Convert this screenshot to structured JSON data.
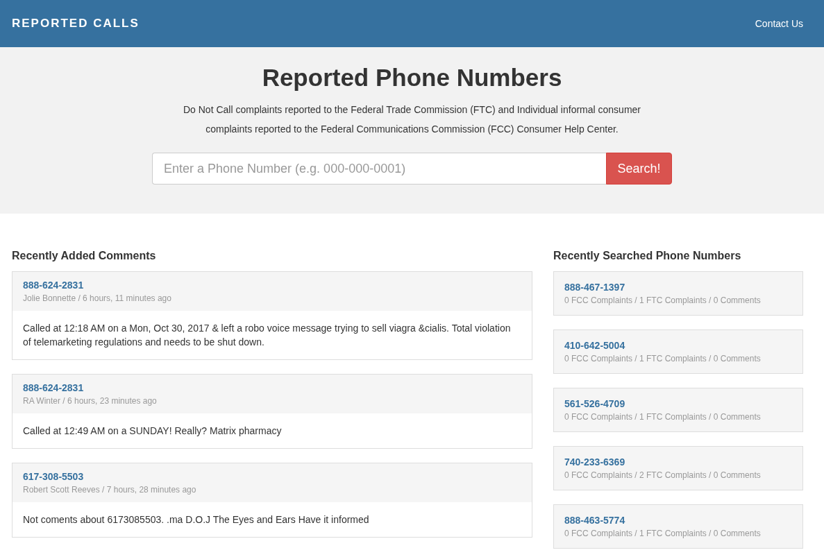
{
  "navbar": {
    "brand": "REPORTED CALLS",
    "links": [
      "Contact Us"
    ]
  },
  "hero": {
    "title": "Reported Phone Numbers",
    "description": "Do Not Call complaints reported to the Federal Trade Commission (FTC) and Individual informal consumer complaints reported to the Federal Communications Commission (FCC) Consumer Help Center.",
    "search": {
      "placeholder": "Enter a Phone Number (e.g. 000-000-0001)",
      "button": "Search!"
    }
  },
  "comments": {
    "heading": "Recently Added Comments",
    "items": [
      {
        "number": "888-624-2831",
        "meta": "Jolie Bonnette / 6 hours, 11 minutes ago",
        "text": "Called at 12:18 AM on a Mon, Oct 30, 2017 & left a robo voice message trying to sell viagra &cialis. Total violation of telemarketing regulations and needs to be shut down."
      },
      {
        "number": "888-624-2831",
        "meta": "RA Winter / 6 hours, 23 minutes ago",
        "text": "Called at 12:49 AM on a SUNDAY! Really? Matrix pharmacy"
      },
      {
        "number": "617-308-5503",
        "meta": "Robert Scott Reeves / 7 hours, 28 minutes ago",
        "text": "Not coments about 6173085503. .ma D.O.J The Eyes and Ears Have it informed"
      }
    ]
  },
  "searched": {
    "heading": "Recently Searched Phone Numbers",
    "items": [
      {
        "number": "888-467-1397",
        "stats": "0 FCC Complaints / 1 FTC Complaints / 0 Comments"
      },
      {
        "number": "410-642-5004",
        "stats": "0 FCC Complaints / 1 FTC Complaints / 0 Comments"
      },
      {
        "number": "561-526-4709",
        "stats": "0 FCC Complaints / 1 FTC Complaints / 0 Comments"
      },
      {
        "number": "740-233-6369",
        "stats": "0 FCC Complaints / 2 FTC Complaints / 0 Comments"
      },
      {
        "number": "888-463-5774",
        "stats": "0 FCC Complaints / 1 FTC Complaints / 0 Comments"
      }
    ]
  }
}
